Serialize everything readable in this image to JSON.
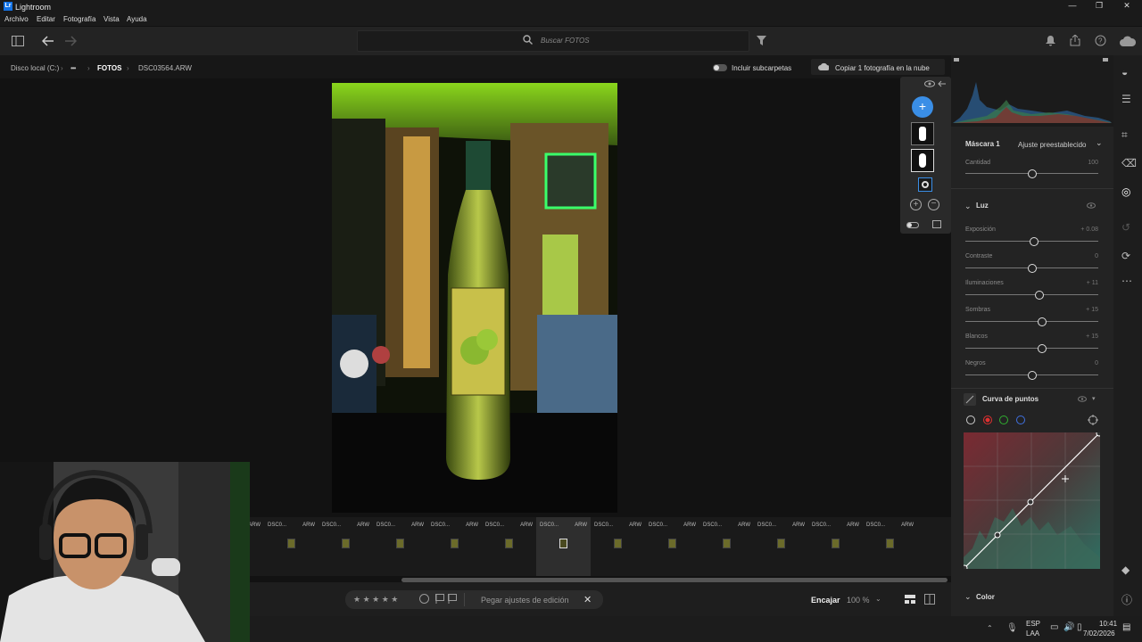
{
  "app": {
    "title": "Lightroom",
    "logo": "Lr"
  },
  "window_controls": {
    "minimize": "—",
    "maximize": "❐",
    "close": "✕"
  },
  "menu": [
    "Archivo",
    "Editar",
    "Fotografía",
    "Vista",
    "Ayuda"
  ],
  "search": {
    "placeholder": "Buscar FOTOS"
  },
  "breadcrumb": {
    "drive": "Disco local (C:)",
    "ellipsis": "•••",
    "folder": "FOTOS",
    "file": "DSC03564.ARW"
  },
  "subfolders": {
    "label": "Incluir subcarpetas"
  },
  "cloud": {
    "label": "Copiar 1 fotografía en la nube"
  },
  "filmstrip": {
    "items": [
      {
        "name": "DSC0...",
        "ext": "ARW"
      },
      {
        "name": "DSC0...",
        "ext": "ARW"
      },
      {
        "name": "DSC0...",
        "ext": "ARW"
      },
      {
        "name": "DSC0...",
        "ext": "ARW"
      },
      {
        "name": "DSC0...",
        "ext": "ARW"
      },
      {
        "name": "DSC0...",
        "ext": "ARW"
      },
      {
        "name": "DSC0...",
        "ext": "ARW"
      },
      {
        "name": "DSC0...",
        "ext": "ARW"
      },
      {
        "name": "DSC0...",
        "ext": "ARW"
      },
      {
        "name": "DSC0...",
        "ext": "ARW"
      },
      {
        "name": "DSC0...",
        "ext": "ARW"
      },
      {
        "name": "DSC0...",
        "ext": "ARW"
      },
      {
        "name": "DSC0...",
        "ext": "ARW"
      }
    ],
    "selected_index": 6
  },
  "bottombar": {
    "stars": "★ ★ ★ ★ ★",
    "paste": "Pegar ajustes de edición",
    "fit": "Encajar",
    "zoom": "100 %"
  },
  "mask": {
    "title": "Máscara 1",
    "preset": "Ajuste preestablecido",
    "amount_label": "Cantidad",
    "amount_value": "100",
    "amount_fraction": 0.5
  },
  "luz": {
    "title": "Luz",
    "sliders": [
      {
        "label": "Exposición",
        "value": "+ 0.08",
        "fraction": 0.52
      },
      {
        "label": "Contraste",
        "value": "0",
        "fraction": 0.5
      },
      {
        "label": "Iluminaciones",
        "value": "+ 11",
        "fraction": 0.56
      },
      {
        "label": "Sombras",
        "value": "+ 15",
        "fraction": 0.58
      },
      {
        "label": "Blancos",
        "value": "+ 15",
        "fraction": 0.58
      },
      {
        "label": "Negros",
        "value": "0",
        "fraction": 0.5
      }
    ]
  },
  "curve": {
    "title": "Curva de puntos",
    "channels": [
      "white",
      "red",
      "green",
      "blue"
    ]
  },
  "color_section": {
    "title": "Color"
  },
  "taskbar": {
    "lang": "ESP",
    "layout": "LAA",
    "time": "10:41",
    "date": "7/02/2026"
  },
  "icons": {
    "panel": "panel-toggle-icon",
    "back": "arrow-left-icon",
    "forward": "arrow-right-icon",
    "filter": "filter-icon",
    "bell": "bell-icon",
    "share": "share-icon",
    "help": "help-icon",
    "cloud": "cloud-icon"
  },
  "colors": {
    "accent": "#1473e6",
    "highlight": "#7ed321"
  }
}
